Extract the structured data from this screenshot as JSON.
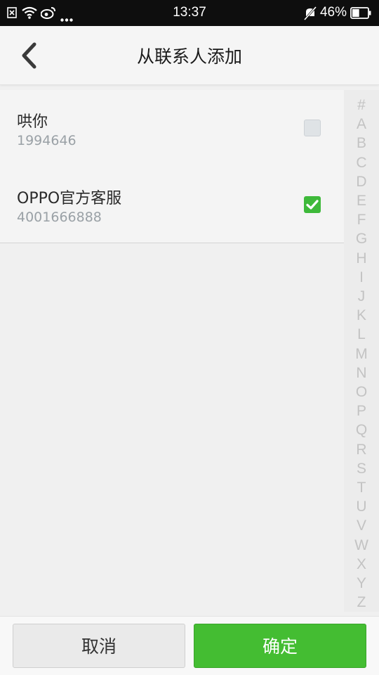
{
  "status_bar": {
    "time": "13:37",
    "battery_percent": "46%",
    "icons": [
      "sim-error-icon",
      "wifi-icon",
      "weibo-icon",
      "more-dots-icon",
      "mute-icon",
      "battery-icon"
    ],
    "battery_level": 0.46
  },
  "app_bar": {
    "title": "从联系人添加",
    "back_icon": "chevron-left-icon"
  },
  "contacts": [
    {
      "name": "哄你",
      "phone": "1994646",
      "checked": false
    },
    {
      "name": "OPPO官方客服",
      "phone": "4001666888",
      "checked": true
    }
  ],
  "alpha_index": [
    "#",
    "A",
    "B",
    "C",
    "D",
    "E",
    "F",
    "G",
    "H",
    "I",
    "J",
    "K",
    "L",
    "M",
    "N",
    "O",
    "P",
    "Q",
    "R",
    "S",
    "T",
    "U",
    "V",
    "W",
    "X",
    "Y",
    "Z"
  ],
  "footer": {
    "cancel_label": "取消",
    "confirm_label": "确定"
  },
  "colors": {
    "accent_green": "#44bd32",
    "status_bar_bg": "#0e0e0e"
  }
}
